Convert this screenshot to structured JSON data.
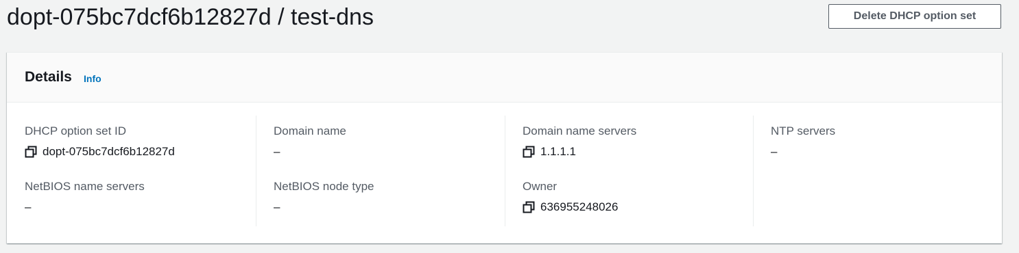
{
  "header": {
    "title": "dopt-075bc7dcf6b12827d / test-dns",
    "delete_button_label": "Delete DHCP option set"
  },
  "details": {
    "title": "Details",
    "info_label": "Info",
    "fields": {
      "dhcp_option_set_id": {
        "label": "DHCP option set ID",
        "value": "dopt-075bc7dcf6b12827d"
      },
      "domain_name": {
        "label": "Domain name",
        "value": "–"
      },
      "domain_name_servers": {
        "label": "Domain name servers",
        "value": "1.1.1.1"
      },
      "ntp_servers": {
        "label": "NTP servers",
        "value": "–"
      },
      "netbios_name_servers": {
        "label": "NetBIOS name servers",
        "value": "–"
      },
      "netbios_node_type": {
        "label": "NetBIOS node type",
        "value": "–"
      },
      "owner": {
        "label": "Owner",
        "value": "636955248026"
      }
    }
  },
  "icons": {
    "copy": "copy-icon"
  },
  "colors": {
    "link": "#0073bb",
    "label": "#545b64",
    "background": "#f2f3f3"
  }
}
